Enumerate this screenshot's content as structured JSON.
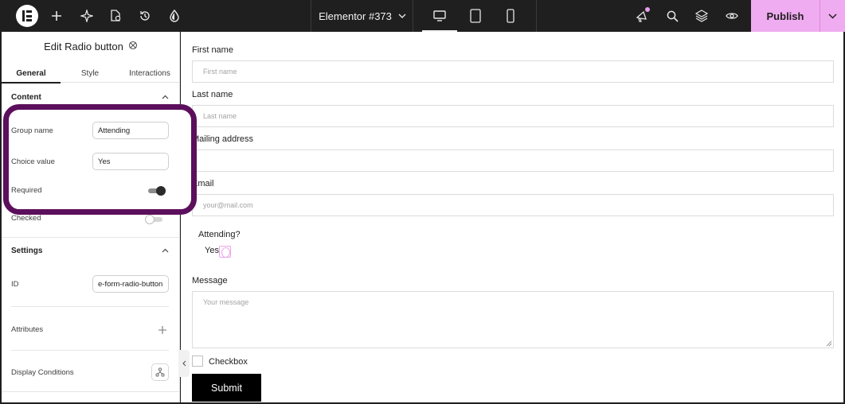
{
  "topbar": {
    "document_title": "Elementor #373",
    "publish_label": "Publish"
  },
  "panel": {
    "title": "Edit Radio button",
    "tabs": [
      "General",
      "Style",
      "Interactions"
    ],
    "content": {
      "heading": "Content",
      "group_name_label": "Group name",
      "group_name_value": "Attending",
      "choice_value_label": "Choice value",
      "choice_value_value": "Yes",
      "required_label": "Required",
      "required_on": true,
      "checked_label": "Checked",
      "checked_on": false
    },
    "settings": {
      "heading": "Settings",
      "id_label": "ID",
      "id_value": "e-form-radio-button",
      "attributes_label": "Attributes",
      "display_conditions_label": "Display Conditions"
    }
  },
  "form": {
    "first_name_label": "First name",
    "first_name_placeholder": "First name",
    "last_name_label": "Last name",
    "last_name_placeholder": "Last name",
    "mailing_address_label": "Mailing address",
    "email_label": "Email",
    "email_placeholder": "your@mail.com",
    "attending_label": "Attending?",
    "yes_label": "Yes",
    "message_label": "Message",
    "message_placeholder": "Your message",
    "checkbox_label": "Checkbox",
    "submit_label": "Submit"
  },
  "colors": {
    "topbar_bg": "#1f1f1f",
    "publish_bg": "#f0acf0",
    "highlight_border": "#5c0f5c",
    "radio_accent": "#e9a6e9"
  }
}
